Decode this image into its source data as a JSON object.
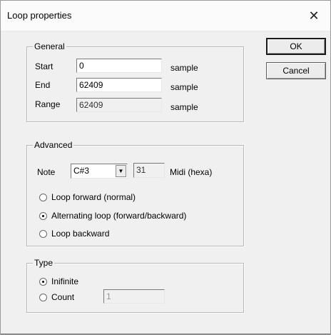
{
  "window": {
    "title": "Loop properties",
    "close_glyph": "✕"
  },
  "buttons": {
    "ok": "OK",
    "cancel": "Cancel"
  },
  "general": {
    "legend": "General",
    "start_label": "Start",
    "start_value": "0",
    "end_label": "End",
    "end_value": "62409",
    "range_label": "Range",
    "range_value": "62409",
    "unit": "sample"
  },
  "advanced": {
    "legend": "Advanced",
    "note_label": "Note",
    "note_value": "C#3",
    "midi_value": "31",
    "midi_label": "Midi (hexa)",
    "dropdown_glyph": "▼",
    "modes": [
      {
        "label": "Loop forward (normal)",
        "selected": false
      },
      {
        "label": "Alternating loop (forward/backward)",
        "selected": true
      },
      {
        "label": "Loop backward",
        "selected": false
      }
    ]
  },
  "type": {
    "legend": "Type",
    "infinite_label": "Inifinite",
    "infinite_selected": true,
    "count_label": "Count",
    "count_selected": false,
    "count_value": "1"
  }
}
